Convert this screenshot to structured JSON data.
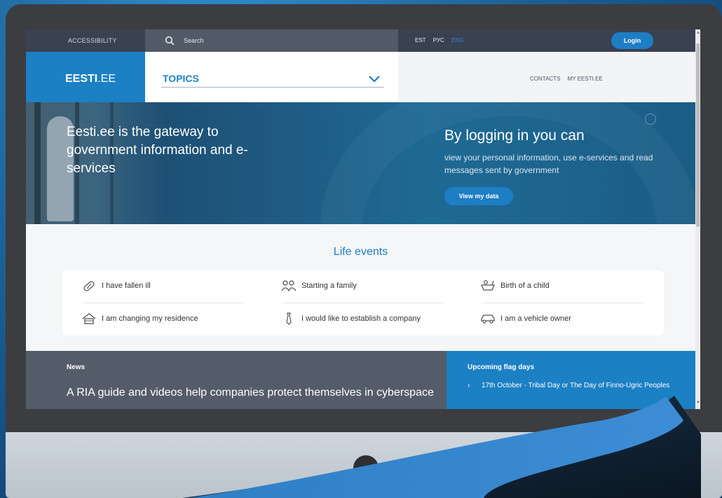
{
  "topbar": {
    "accessibility": "ACCESSIBILITY",
    "search_placeholder": "Search",
    "languages": [
      "EST",
      "РУС",
      "ENG"
    ],
    "active_language": "ENG",
    "login": "Login"
  },
  "header": {
    "logo_main": "EESTI",
    "logo_suffix": ".EE",
    "topics": "TOPICS",
    "links": [
      "CONTACTS",
      "MY EESTI.EE"
    ]
  },
  "hero": {
    "heading": "Eesti.ee is the gateway to government information and e-services",
    "login_title": "By logging in you can",
    "login_text": "view your personal information, use e-services and read messages sent by government",
    "view_button": "View my data"
  },
  "life_events": {
    "title": "Life events",
    "items": [
      {
        "label": "I have fallen ill",
        "icon": "pill-icon"
      },
      {
        "label": "Starting a family",
        "icon": "family-icon"
      },
      {
        "label": "Birth of a child",
        "icon": "baby-bath-icon"
      },
      {
        "label": "I am changing my residence",
        "icon": "house-icon"
      },
      {
        "label": "I would like to establish a company",
        "icon": "tie-icon"
      },
      {
        "label": "I am a vehicle owner",
        "icon": "car-icon"
      }
    ]
  },
  "news": {
    "label": "News",
    "headline": "A RIA guide and videos help companies protect themselves in cyberspace"
  },
  "flag_days": {
    "label": "Upcoming flag days",
    "items": [
      "17th October - Tribal Day or The Day of Finno-Ugric Peoples"
    ]
  },
  "colors": {
    "accent": "#1c80c4",
    "topbar": "#3a4150",
    "news_bg": "#555c69"
  }
}
